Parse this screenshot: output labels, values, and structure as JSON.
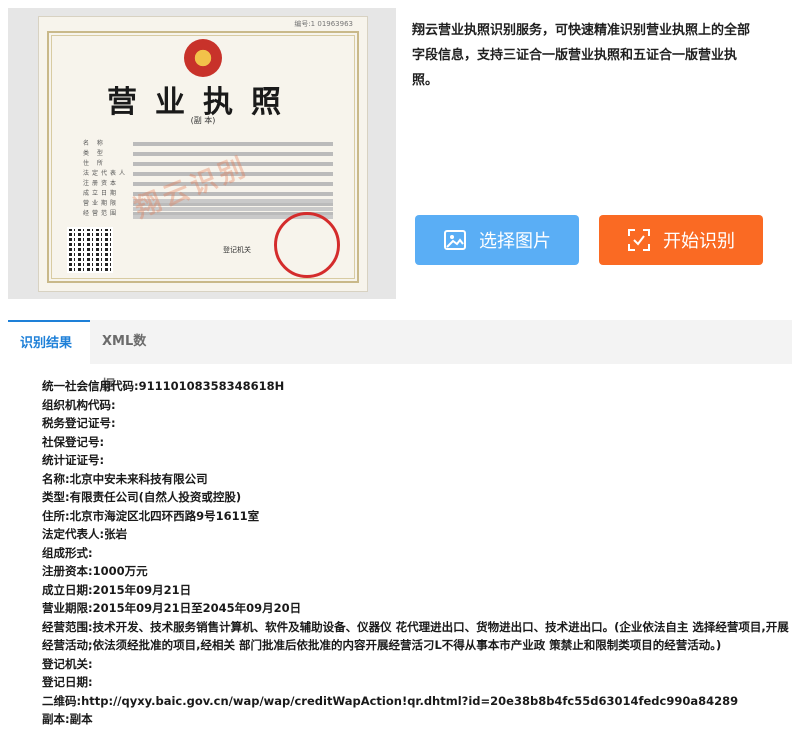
{
  "license_image": {
    "serial_number": "编号:1 01963963",
    "title": "营业执照",
    "subtitle": "(副 本)",
    "field_labels": [
      "名 称",
      "类 型",
      "住 所",
      "法定代表人",
      "注册资本",
      "成立日期",
      "营业期限",
      "经营范围"
    ],
    "registration_org": "登记机关",
    "seal_text": "北京市工商行政管理局",
    "watermark": "翔云识别"
  },
  "description": "翔云营业执照识别服务，可快速精准识别营业执照上的全部字段信息，支持三证合一版营业执照和五证合一版营业执照。",
  "buttons": {
    "select_image": "选择图片",
    "start_recognition": "开始识别"
  },
  "tabs": {
    "result": "识别结果",
    "xml": "XML数据"
  },
  "colors": {
    "select_button": "#5aaef5",
    "start_button": "#fa6a23",
    "active_tab": "#1e80d8"
  },
  "result_lines": [
    "统一社会信用代码:91110108358348618H",
    "组织机构代码:",
    "税务登记证号:",
    "社保登记号:",
    "统计证证号:",
    "名称:北京中安未来科技有限公司",
    "类型:有限责任公司(自然人投资或控股)",
    "住所:北京市海淀区北四环西路9号1611室",
    "法定代表人:张岩",
    "组成形式:",
    "注册资本:1000万元",
    "成立日期:2015年09月21日",
    "营业期限:2015年09月21日至2045年09月20日",
    "经营范围:技术开发、技术服务销售计算机、软件及辅助设备、仪器仪 花代理进出口、货物进出口、技术进出口。(企业依法自主 选择经营项目,开展经营活动;依法须经批准的项目,经相关 部门批准后依批准的内容开展经营活刁L不得从事本市产业政 策禁止和限制类项目的经营活动。)",
    "登记机关:",
    "登记日期:",
    "二维码:http://qyxy.baic.gov.cn/wap/wap/creditWapAction!qr.dhtml?id=20e38b8b4fc55d63014fedc990a84289",
    "副本:副本"
  ]
}
